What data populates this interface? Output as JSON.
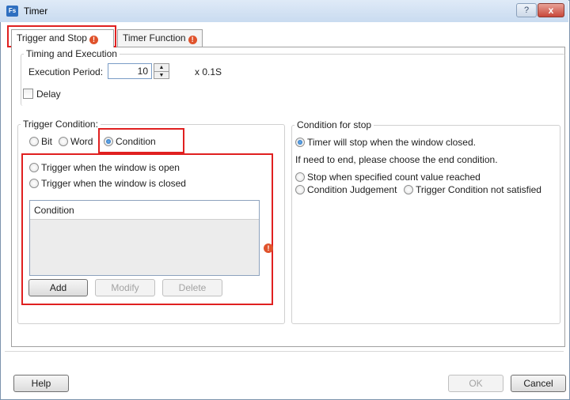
{
  "window": {
    "app_icon_text": "Fs",
    "title": "Timer",
    "help_glyph": "?",
    "close_glyph": "x"
  },
  "tabs": [
    {
      "label": "Trigger and Stop",
      "active": true
    },
    {
      "label": "Timer Function",
      "active": false
    }
  ],
  "timing": {
    "group_title": "Timing and Execution",
    "period_label": "Execution Period:",
    "period_value": "10",
    "unit": "x 0.1S",
    "delay_label": "Delay",
    "delay_checked": false
  },
  "trigger": {
    "group_title": "Trigger Condition:",
    "types": [
      {
        "label": "Bit",
        "checked": false
      },
      {
        "label": "Word",
        "checked": false
      },
      {
        "label": "Condition",
        "checked": true
      }
    ],
    "open_label": "Trigger when the window is open",
    "closed_label": "Trigger when the window is closed",
    "list_header": "Condition",
    "add_label": "Add",
    "modify_label": "Modify",
    "delete_label": "Delete"
  },
  "stop": {
    "group_title": "Condition for stop",
    "option_window_closed": "Timer will stop when the window closed.",
    "hint": "If need to end, please choose the end condition.",
    "option_count": "Stop when specified count value reached",
    "option_judgement": "Condition Judgement",
    "option_not_satisfied": "Trigger Condition not satisfied"
  },
  "footer": {
    "help_label": "Help",
    "ok_label": "OK",
    "cancel_label": "Cancel"
  },
  "colors": {
    "highlight": "#e02020",
    "warning": "#e0532c",
    "radio_selected": "#1c62b3"
  }
}
